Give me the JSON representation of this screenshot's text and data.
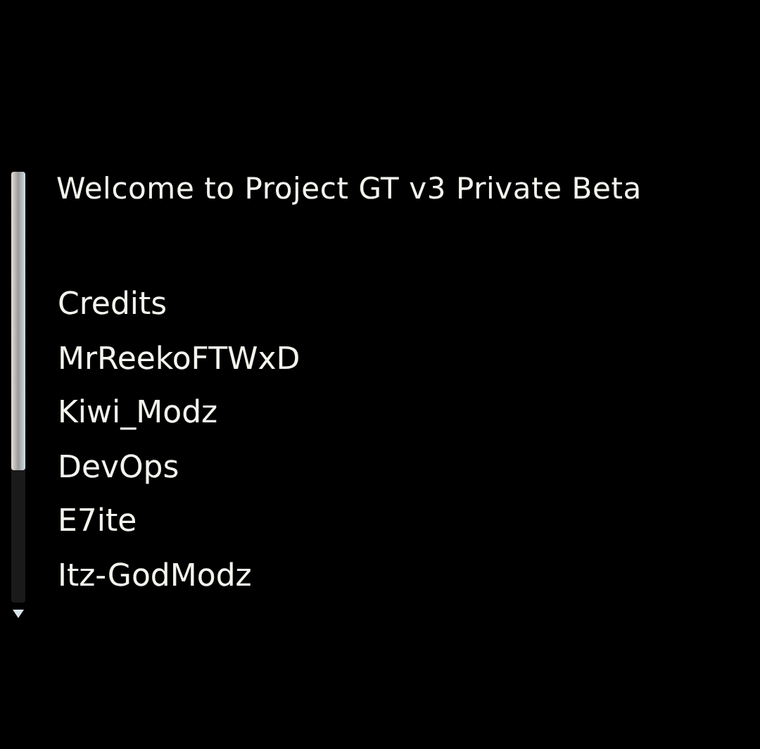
{
  "menu": {
    "title": "Welcome to Project GT v3 Private Beta",
    "items": [
      "Credits",
      "MrReekoFTWxD",
      "Kiwi_Modz",
      "DevOps",
      "E7ite",
      "Itz-GodModz"
    ]
  }
}
